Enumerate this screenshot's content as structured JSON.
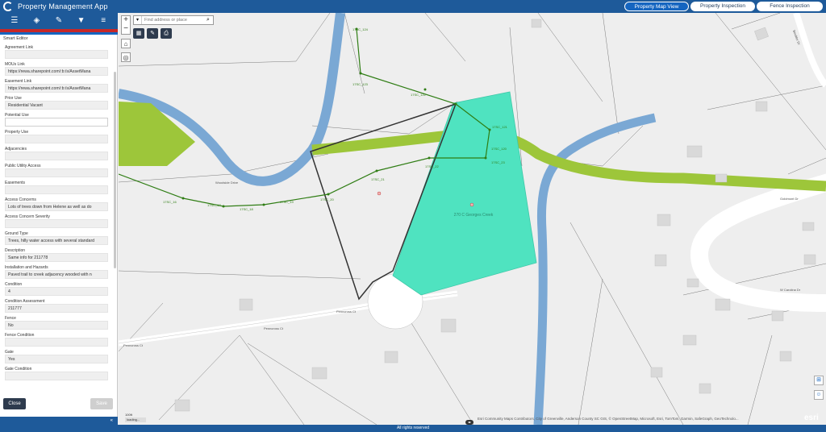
{
  "app": {
    "title": "Property Management App"
  },
  "tabs": [
    "Property Map View",
    "Property Inspection",
    "Fence Inspection"
  ],
  "toolbar": {
    "icons": [
      "list-icon",
      "layers-icon",
      "measure-icon",
      "filter-icon",
      "menu-icon"
    ]
  },
  "panel": {
    "title": "Smart Editor",
    "fields": [
      {
        "label": "Agreement Link",
        "value": ""
      },
      {
        "label": "MOUs Link",
        "value": "https://rewa.sharepoint.com/:b:/s/AssetMana"
      },
      {
        "label": "Easement Link",
        "value": "https://rewa.sharepoint.com/:b:/s/AssetMana"
      },
      {
        "label": "Prior Use",
        "value": "Residential Vacant"
      },
      {
        "label": "Potential Use",
        "value": ""
      },
      {
        "label": "Property Use",
        "value": ""
      },
      {
        "label": "Adjacencies",
        "value": ""
      },
      {
        "label": "Public Utility Access",
        "value": ""
      },
      {
        "label": "Easements",
        "value": ""
      },
      {
        "label": "Access Concerns",
        "value": "Lots of trees down from Helene as well as do"
      },
      {
        "label": "Access Concern Severity",
        "value": ""
      },
      {
        "label": "Ground Type",
        "value": "Trees, hilly water access with several standard"
      },
      {
        "label": "Description",
        "value": "Same info for 211778"
      },
      {
        "label": "Installation and Hazards",
        "value": "Paved trail to creek adjacency wooded with n"
      },
      {
        "label": "Condition",
        "value": "4"
      },
      {
        "label": "Condition Assessment",
        "value": "211777"
      },
      {
        "label": "Fence",
        "value": "No"
      },
      {
        "label": "Fence Condition",
        "value": ""
      },
      {
        "label": "Gate",
        "value": "Yes"
      },
      {
        "label": "Gate Condition",
        "value": ""
      }
    ],
    "close_label": "Close",
    "save_label": "Save",
    "collapse_label": "«"
  },
  "map": {
    "search_placeholder": "Find address or place",
    "zoom_in": "+",
    "zoom_out": "−",
    "attribution": "Esri Community Maps Contributors, City of Greenville, Anderson County SC GIS, © OpenStreetMap, Microsoft, Esri, TomTom, Garmin, SafeGraph, GeoTechnolo...",
    "esri_logo": "esri",
    "scale_label": "100ft",
    "loading_label": "loading...",
    "parcel_label": "270 C Georges Creek",
    "sewer_labels": [
      "17SC_124",
      "17SC_123",
      "17SC_122",
      "17SC_121",
      "17SC_120",
      "17SC_23",
      "17SC_22",
      "17SC_21",
      "17SC_20",
      "17SC_19",
      "17SC_18",
      "17SC_17",
      "17SC_16"
    ],
    "road_labels": [
      "Penncross Ct",
      "Penncross Ct",
      "Penncross Ct",
      "Goldmont Dr",
      "W Carolina Dr",
      "Woodside Drive",
      "Boulder Dr"
    ]
  },
  "footer": {
    "text": "All rights reserved"
  },
  "colors": {
    "header": "#1e5a9a",
    "river": "#7aa8d4",
    "greenway": "#9dc63a",
    "parcel": "#4fe3c0",
    "sewer": "#2f7d14"
  }
}
